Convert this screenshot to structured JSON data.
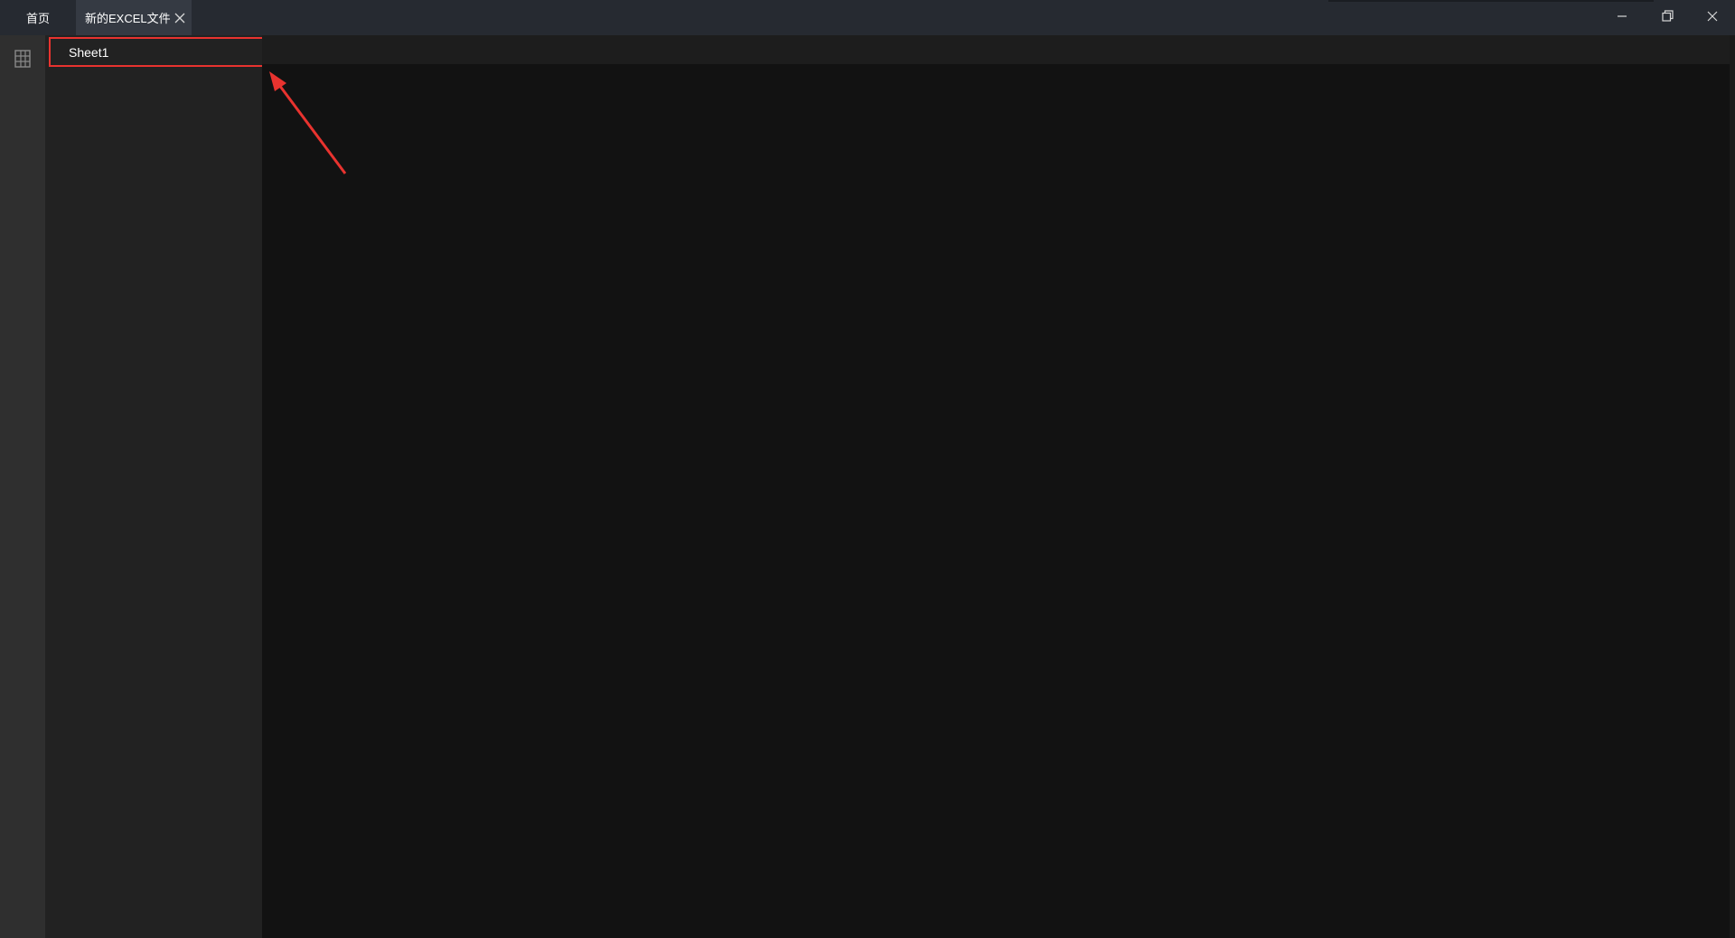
{
  "tabs": {
    "home_label": "首页",
    "file_label": "新的EXCEL文件"
  },
  "sheets": [
    {
      "label": "Sheet1"
    }
  ],
  "icons": {
    "tab_close": "close-icon",
    "minimize": "minimize-icon",
    "restore": "restore-icon",
    "close": "close-icon",
    "sheets_panel": "building-icon"
  },
  "colors": {
    "highlight": "#e8332f",
    "titlebar": "#262a31",
    "active_tab": "#353a43"
  }
}
